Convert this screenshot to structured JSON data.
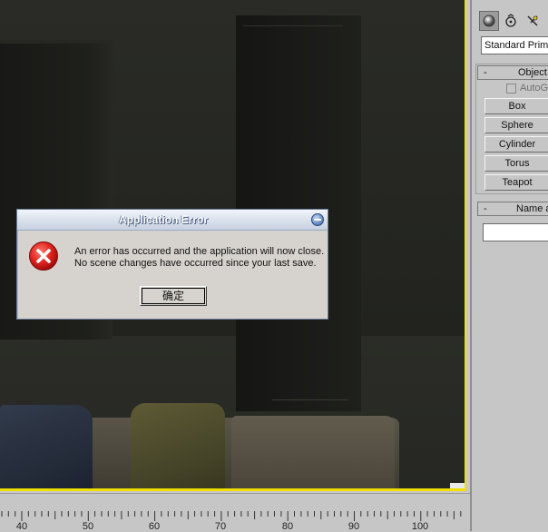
{
  "dialog": {
    "title": "Application Error",
    "message_line1": "An error has occurred and the application will now close.",
    "message_line2": "No scene changes have occurred since your last save.",
    "ok_label": "确定",
    "icon": "error-x-icon"
  },
  "command_panel": {
    "tabs": [
      {
        "icon": "geometry-sphere-icon",
        "active": true
      },
      {
        "icon": "shapes-icon",
        "active": false
      },
      {
        "icon": "lights-icon",
        "active": false
      }
    ],
    "dropdown_value": "Standard Primitives",
    "object_type_rollout": {
      "collapse_symbol": "-",
      "title": "Object Type",
      "autogrid_label": "AutoGrid",
      "buttons": [
        "Box",
        "Sphere",
        "Cylinder",
        "Torus",
        "Teapot"
      ]
    },
    "name_color_rollout": {
      "collapse_symbol": "-",
      "title": "Name and Color",
      "name_value": ""
    }
  },
  "timeline": {
    "labels": [
      "40",
      "50",
      "60",
      "70",
      "80",
      "90",
      "100"
    ]
  },
  "colors": {
    "viewport_active_border": "#f0e000",
    "dialog_bg": "#d6d3ce",
    "error_red": "#d41e1e"
  }
}
